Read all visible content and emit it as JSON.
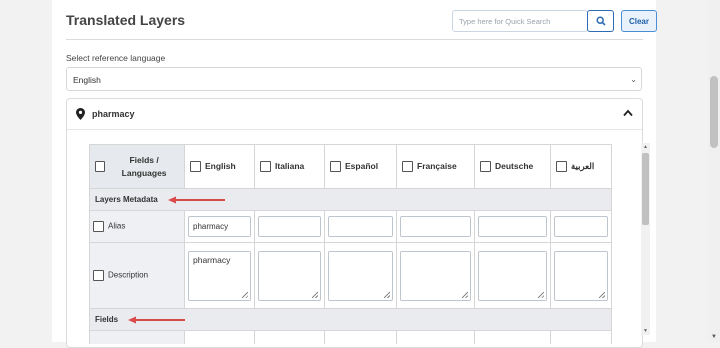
{
  "header": {
    "title": "Translated Layers",
    "search_placeholder": "Type here for Quick Search",
    "clear_label": "Clear"
  },
  "reference": {
    "label": "Select reference language",
    "selected": "English"
  },
  "layer": {
    "name": "pharmacy"
  },
  "table": {
    "first_header": "Fields / Languages",
    "languages": [
      "English",
      "Italiana",
      "Español",
      "Française",
      "Deutsche",
      "العربية"
    ],
    "sections": {
      "metadata": "Layers Metadata",
      "fields": "Fields"
    },
    "rows": {
      "alias_label": "Alias",
      "description_label": "Description",
      "alias_value_english": "pharmacy",
      "description_value_english": "pharmacy"
    }
  },
  "colors": {
    "accent": "#2d6cb5",
    "arrow": "#d94b4b",
    "header_bg": "#e6eaee"
  },
  "icons": [
    "search-icon",
    "map-pin-icon",
    "chevron-up-icon",
    "chevron-down-icon",
    "red-arrow-icon"
  ]
}
